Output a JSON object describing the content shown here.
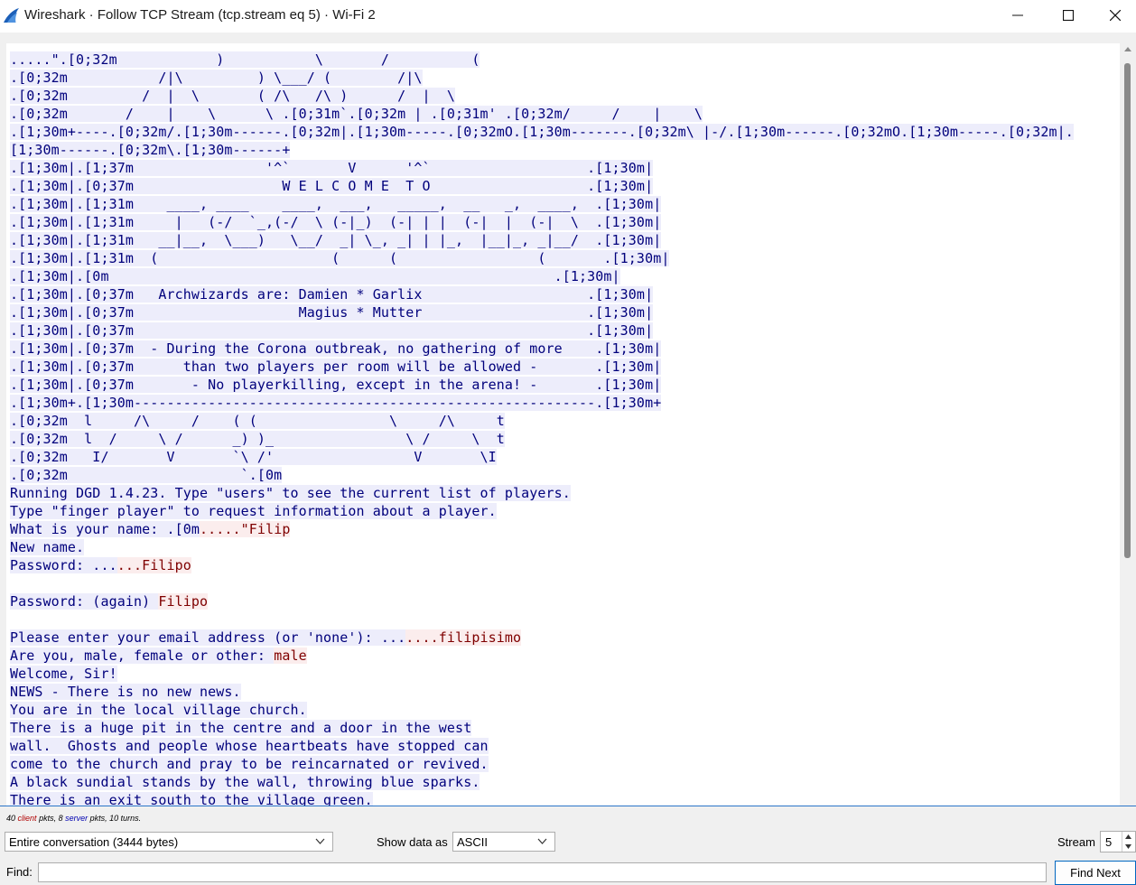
{
  "window": {
    "title": "Wireshark · Follow TCP Stream (tcp.stream eq 5) · Wi-Fi 2",
    "app_icon": "wireshark-fin-icon",
    "controls": [
      "minimize-icon",
      "maximize-icon",
      "close-icon"
    ]
  },
  "colors": {
    "server_bg": "#ededfb",
    "server_fg": "#00007c",
    "client_bg": "#fbeded",
    "client_fg": "#7f0000"
  },
  "stream_lines": [
    [
      {
        "t": ".....\".[0;32m            )           \\       /          (",
        "c": "s"
      }
    ],
    [
      {
        "t": ".[0;32m           /|\\         ) \\___/ (        /|\\",
        "c": "s"
      }
    ],
    [
      {
        "t": ".[0;32m         /  |  \\       ( /\\   /\\ )      /  |  \\",
        "c": "s"
      }
    ],
    [
      {
        "t": ".[0;32m       /    |    \\      \\ .[0;31m`.[0;32m | .[0;31m' .[0;32m/     /    |    \\",
        "c": "s"
      }
    ],
    [
      {
        "t": ".[1;30m+----.[0;32m/.[1;30m------.[0;32m|.[1;30m-----.[0;32mO.[1;30m-------.[0;32m\\ |-/.[1;30m------.[0;32mO.[1;30m-----.[0;32m|.",
        "c": "s"
      }
    ],
    [
      {
        "t": "[1;30m------.[0;32m\\.[1;30m------+",
        "c": "s"
      }
    ],
    [
      {
        "t": ".[1;30m|.[1;37m                '^`       V      '^`                   .[1;30m|",
        "c": "s"
      }
    ],
    [
      {
        "t": ".[1;30m|.[0;37m                  W E L C O M E  T O                   .[1;30m|",
        "c": "s"
      }
    ],
    [
      {
        "t": ".[1;30m|.[1;31m    ____, ____    ____,  ___,   _____,  __   _,  ____,  .[1;30m|",
        "c": "s"
      }
    ],
    [
      {
        "t": ".[1;30m|.[1;31m     |   (-/  `_,(-/  \\ (-|_)  (-| | |  (-|  |  (-|  \\  .[1;30m|",
        "c": "s"
      }
    ],
    [
      {
        "t": ".[1;30m|.[1;31m   __|__,  \\___)   \\__/  _| \\_, _| | |_,  |__|_, _|__/  .[1;30m|",
        "c": "s"
      }
    ],
    [
      {
        "t": ".[1;30m|.[1;31m  (                     (      (                 (       .[1;30m|",
        "c": "s"
      }
    ],
    [
      {
        "t": ".[1;30m|.[0m                                                      .[1;30m|",
        "c": "s"
      }
    ],
    [
      {
        "t": ".[1;30m|.[0;37m   Archwizards are: Damien * Garlix                    .[1;30m|",
        "c": "s"
      }
    ],
    [
      {
        "t": ".[1;30m|.[0;37m                    Magius * Mutter                    .[1;30m|",
        "c": "s"
      }
    ],
    [
      {
        "t": ".[1;30m|.[0;37m                                                       .[1;30m|",
        "c": "s"
      }
    ],
    [
      {
        "t": ".[1;30m|.[0;37m  - During the Corona outbreak, no gathering of more    .[1;30m|",
        "c": "s"
      }
    ],
    [
      {
        "t": ".[1;30m|.[0;37m      than two players per room will be allowed -       .[1;30m|",
        "c": "s"
      }
    ],
    [
      {
        "t": ".[1;30m|.[0;37m       - No playerkilling, except in the arena! -       .[1;30m|",
        "c": "s"
      }
    ],
    [
      {
        "t": ".[1;30m+.[1;30m--------------------------------------------------------.[1;30m+",
        "c": "s"
      }
    ],
    [
      {
        "t": ".[0;32m  l     /\\     /    ( (                \\     /\\     t",
        "c": "s"
      }
    ],
    [
      {
        "t": ".[0;32m  l  /     \\ /      _) )_                \\ /     \\  t",
        "c": "s"
      }
    ],
    [
      {
        "t": ".[0;32m   I/       V       `\\ /'                 V       \\I",
        "c": "s"
      }
    ],
    [
      {
        "t": ".[0;32m                     `.[0m",
        "c": "s"
      }
    ],
    [
      {
        "t": "Running DGD 1.4.23. Type \"users\" to see the current list of players.",
        "c": "s"
      }
    ],
    [
      {
        "t": "Type \"finger player\" to request information about a player.",
        "c": "s"
      }
    ],
    [
      {
        "t": "What is your name: .[0m",
        "c": "s"
      },
      {
        "t": ".....\"Filip",
        "c": "c"
      }
    ],
    [
      {
        "t": "New name.",
        "c": "s"
      }
    ],
    [
      {
        "t": "Password: ...",
        "c": "s"
      },
      {
        "t": "...Filipo",
        "c": "c"
      }
    ],
    [
      {
        "t": "",
        "c": "s"
      }
    ],
    [
      {
        "t": "Password: (again) ",
        "c": "s"
      },
      {
        "t": "Filipo",
        "c": "c"
      }
    ],
    [
      {
        "t": "",
        "c": "s"
      }
    ],
    [
      {
        "t": "Please enter your email address (or 'none'): ...",
        "c": "s"
      },
      {
        "t": "....filipisimo",
        "c": "c"
      }
    ],
    [
      {
        "t": "Are you, male, female or other: ",
        "c": "s"
      },
      {
        "t": "male",
        "c": "c"
      }
    ],
    [
      {
        "t": "Welcome, Sir!",
        "c": "s"
      }
    ],
    [
      {
        "t": "NEWS - There is no new news.",
        "c": "s"
      }
    ],
    [
      {
        "t": "You are in the local village church.",
        "c": "s"
      }
    ],
    [
      {
        "t": "There is a huge pit in the centre and a door in the west",
        "c": "s"
      }
    ],
    [
      {
        "t": "wall.  Ghosts and people whose heartbeats have stopped can",
        "c": "s"
      }
    ],
    [
      {
        "t": "come to the church and pray to be reincarnated or revived.",
        "c": "s"
      }
    ],
    [
      {
        "t": "A black sundial stands by the wall, throwing blue sparks.",
        "c": "s"
      }
    ],
    [
      {
        "t": "There is an exit south to the village green.",
        "c": "s"
      }
    ]
  ],
  "stats": {
    "client_count": "40",
    "client_word": "client",
    "middle": "pkts, 8",
    "server_word": "server",
    "tail": "pkts, 10 turns."
  },
  "controls": {
    "conversation_select": "Entire conversation (3444 bytes)",
    "show_data_as_label": "Show data as",
    "show_data_as_value": "ASCII",
    "stream_label": "Stream",
    "stream_value": "5",
    "find_label": "Find:",
    "find_value": "",
    "find_next_label": "Find Next"
  }
}
